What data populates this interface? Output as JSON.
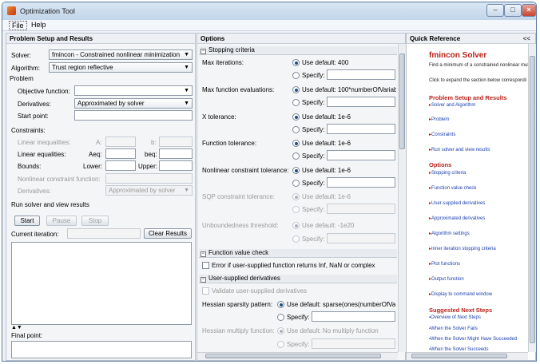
{
  "window": {
    "title": "Optimization Tool",
    "min_glyph": "–",
    "max_glyph": "□",
    "close_glyph": "×"
  },
  "menu": {
    "file": "File",
    "help": "Help"
  },
  "left": {
    "header": "Problem Setup and Results",
    "solver_label": "Solver:",
    "solver_value": "fmincon - Constrained nonlinear minimization",
    "algorithm_label": "Algorithm:",
    "algorithm_value": "Trust region reflective",
    "problem_label": "Problem",
    "objective_label": "Objective function:",
    "objective_value": "",
    "derivatives_label": "Derivatives:",
    "derivatives_value": "Approximated by solver",
    "start_point_label": "Start point:",
    "constraints_label": "Constraints:",
    "lin_ineq_label": "Linear inequalities:",
    "A_label": "A:",
    "b_label": "b:",
    "lin_eq_label": "Linear equalities:",
    "Aeq_label": "Aeq:",
    "beq_label": "beq:",
    "bounds_label": "Bounds:",
    "lower_label": "Lower:",
    "upper_label": "Upper:",
    "nonlin_label": "Nonlinear constraint function:",
    "nonlin_deriv_label": "Derivatives:",
    "nonlin_deriv_value": "Approximated by solver",
    "run_label": "Run solver and view results",
    "start_btn": "Start",
    "pause_btn": "Pause",
    "stop_btn": "Stop",
    "current_iter_label": "Current iteration:",
    "clear_btn": "Clear Results",
    "final_point_label": "Final point:"
  },
  "mid": {
    "header": "Options",
    "stopping_title": "Stopping criteria",
    "max_iter_label": "Max iterations:",
    "max_iter_default": "Use default: 400",
    "max_fevals_label": "Max function evaluations:",
    "max_fevals_default": "Use default: 100*numberOfVariab",
    "xtol_label": "X tolerance:",
    "xtol_default": "Use default: 1e-6",
    "ftol_label": "Function tolerance:",
    "ftol_default": "Use default: 1e-6",
    "nonlin_tol_label": "Nonlinear constraint tolerance:",
    "nonlin_tol_default": "Use default: 1e-6",
    "sqp_tol_label": "SQP constraint tolerance:",
    "sqp_tol_default": "Use default: 1e-6",
    "unbounded_label": "Unboundedness threshold:",
    "unbounded_default": "Use default: -1e20",
    "specify_label": "Specify:",
    "fvc_title": "Function value check",
    "fvc_check_label": "Error if user-supplied function returns Inf, NaN or complex",
    "usd_title": "User-supplied derivatives",
    "validate_label": "Validate user-supplied derivatives",
    "hess_sparsity_label": "Hessian sparsity pattern:",
    "hess_sparsity_default": "Use default: sparse(ones(numberOfVar",
    "hess_mult_label": "Hessian multiply function:",
    "hess_mult_default": "Use default: No multiply function"
  },
  "quickref": {
    "header": "Quick Reference",
    "collapse_glyph": "<<",
    "title": "fmincon Solver",
    "desc": "Find a minimum of a constrained nonlinear mul",
    "hint": "Click to expand the section below correspondi",
    "psr_head": "Problem Setup and Results",
    "psr_links": [
      "Solver and Algorithm",
      "Problem",
      "Constraints",
      "Run solver and view results"
    ],
    "options_head": "Options",
    "options_links": [
      "Stopping criteria",
      "Function value check",
      "User-supplied derivatives",
      "Approximated derivatives",
      "Algorithm settings",
      "Inner iteration stopping criteria",
      "Plot functions",
      "Output function",
      "Display to command window"
    ],
    "next_head": "Suggested Next Steps",
    "next_links": [
      "Overview of Next Steps",
      "When the Solver Fails",
      "When the Solver Might Have Succeeded",
      "When the Solver Succeeds"
    ]
  },
  "colors": {
    "accent_red": "#b8221a",
    "link_blue": "#1a3fae",
    "frame": "#5b7ba0"
  }
}
